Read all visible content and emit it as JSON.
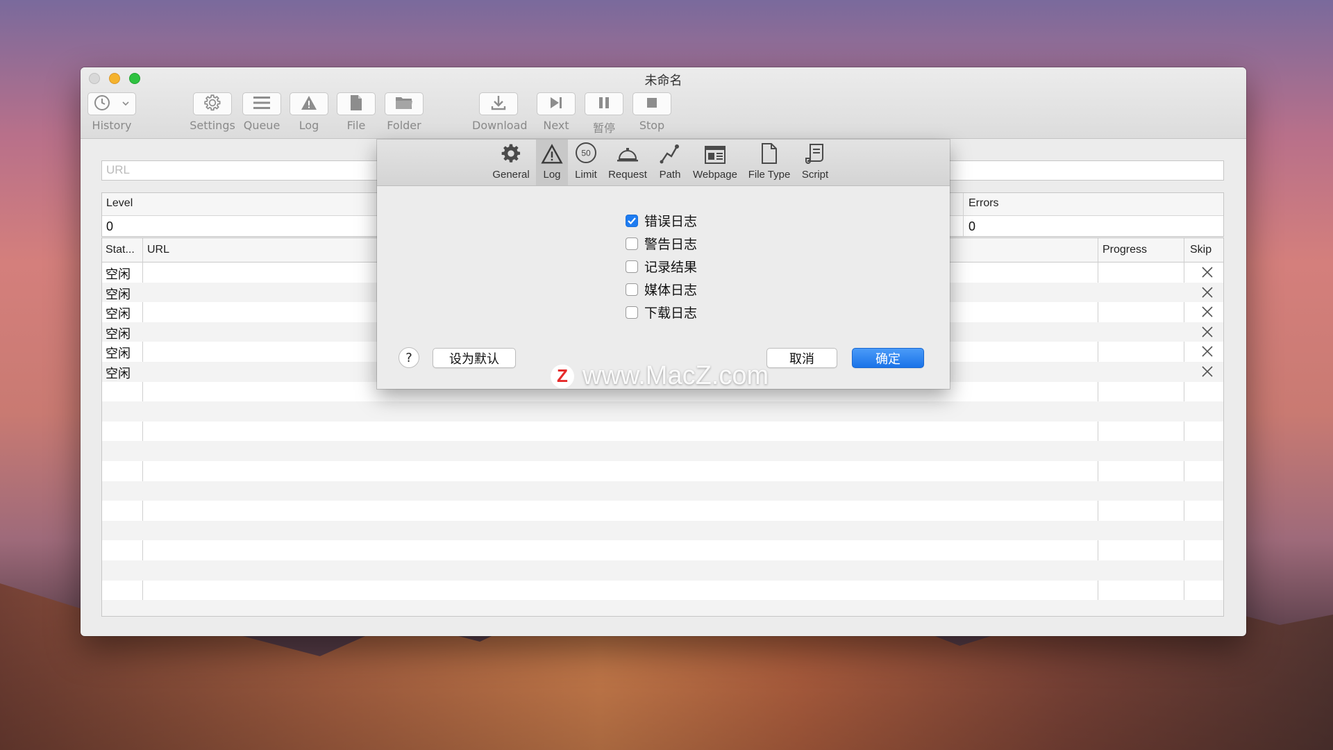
{
  "window": {
    "title": "未命名"
  },
  "toolbar": {
    "history": "History",
    "settings": "Settings",
    "queue": "Queue",
    "log": "Log",
    "file": "File",
    "folder": "Folder",
    "download": "Download",
    "next": "Next",
    "pause": "暂停",
    "stop": "Stop"
  },
  "url_field": {
    "placeholder": "URL"
  },
  "stats": {
    "level_label": "Level",
    "level_value": "0",
    "errors_label": "Errors",
    "errors_value": "0"
  },
  "table": {
    "columns": [
      "Stat...",
      "URL",
      "Progress",
      "Skip"
    ],
    "rows": [
      "空闲",
      "空闲",
      "空闲",
      "空闲",
      "空闲",
      "空闲"
    ]
  },
  "prefs": {
    "tabs": [
      "General",
      "Log",
      "Limit",
      "Request",
      "Path",
      "Webpage",
      "File Type",
      "Script"
    ],
    "selected_tab": "Log",
    "limit_badge": "50",
    "options": [
      {
        "label": "错误日志",
        "checked": true
      },
      {
        "label": "警告日志",
        "checked": false
      },
      {
        "label": "记录结果",
        "checked": false
      },
      {
        "label": "媒体日志",
        "checked": false
      },
      {
        "label": "下载日志",
        "checked": false
      }
    ],
    "help": "?",
    "set_default": "设为默认",
    "cancel": "取消",
    "ok": "确定"
  },
  "watermark": {
    "logo": "Z",
    "text": "www.MacZ.com"
  },
  "colors": {
    "accent": "#1e7cf1",
    "window_bg": "#ececec"
  }
}
